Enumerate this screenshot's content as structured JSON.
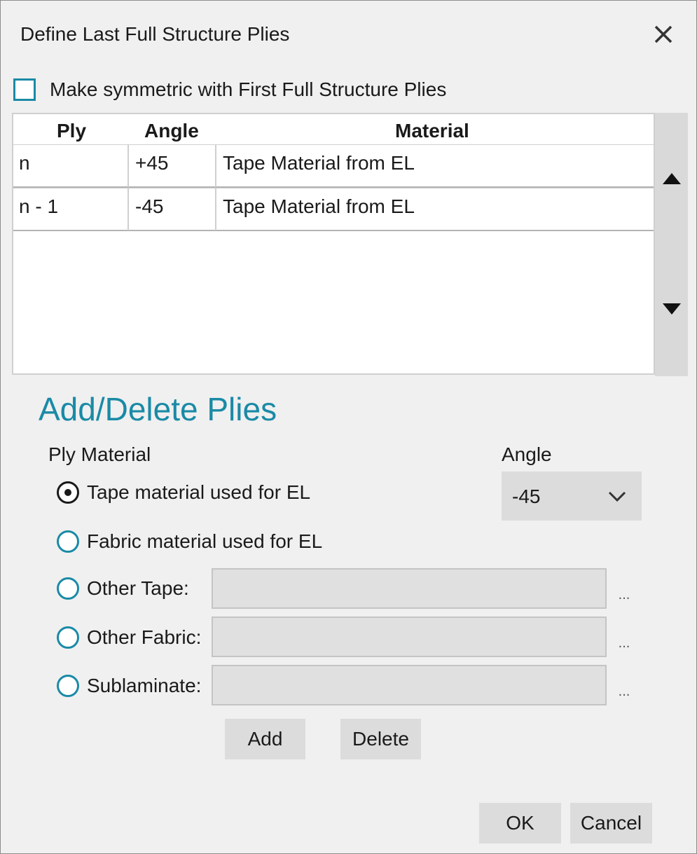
{
  "dialog": {
    "title": "Define Last Full Structure Plies",
    "close_icon": "close-icon"
  },
  "symmetric": {
    "label": "Make symmetric with First Full Structure Plies",
    "checked": false
  },
  "grid": {
    "headers": {
      "ply": "Ply",
      "angle": "Angle",
      "material": "Material"
    },
    "rows": [
      {
        "ply": "n",
        "angle": "+45",
        "material": "Tape Material from EL"
      },
      {
        "ply": "n - 1",
        "angle": "-45",
        "material": "Tape Material from EL"
      }
    ],
    "move_up_icon": "triangle-up-icon",
    "move_down_icon": "triangle-down-icon"
  },
  "add_delete": {
    "title": "Add/Delete Plies",
    "ply_material_label": "Ply Material",
    "angle_label": "Angle",
    "angle_value": "-45",
    "options": [
      {
        "label": "Tape material used for EL",
        "checked": true
      },
      {
        "label": "Fabric material used for EL",
        "checked": false
      },
      {
        "label": "Other Tape:",
        "checked": false
      },
      {
        "label": "Other Fabric:",
        "checked": false
      },
      {
        "label": "Sublaminate:",
        "checked": false
      }
    ],
    "browse_label": "...",
    "add_label": "Add",
    "delete_label": "Delete"
  },
  "footer": {
    "ok_label": "OK",
    "cancel_label": "Cancel"
  },
  "colors": {
    "accent": "#1a8aa6",
    "dialog_bg": "#f0f0f0",
    "button_bg": "#dcdcdc"
  }
}
